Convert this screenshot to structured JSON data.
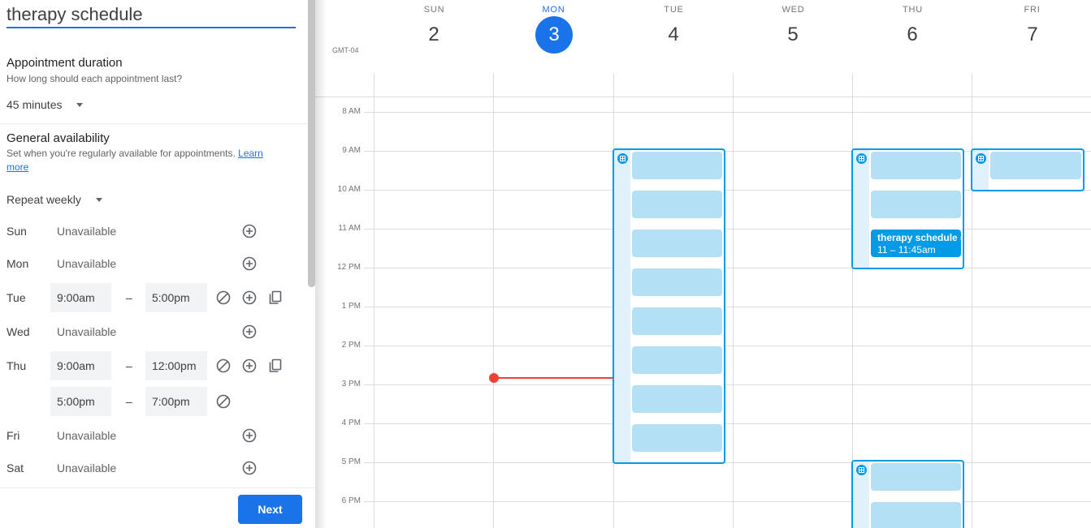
{
  "form": {
    "title_value": "therapy schedule",
    "duration": {
      "title": "Appointment duration",
      "subtitle": "How long should each appointment last?",
      "value": "45 minutes"
    },
    "availability": {
      "title": "General availability",
      "subtitle": "Set when you're regularly available for appointments.",
      "learn_more": "Learn more",
      "repeat": "Repeat weekly"
    },
    "dash": "–",
    "days": [
      {
        "label": "Sun",
        "status": "Unavailable"
      },
      {
        "label": "Mon",
        "status": "Unavailable"
      },
      {
        "label": "Tue",
        "start": "9:00am",
        "end": "5:00pm"
      },
      {
        "label": "Wed",
        "status": "Unavailable"
      },
      {
        "label": "Thu",
        "start": "9:00am",
        "end": "12:00pm",
        "start2": "5:00pm",
        "end2": "7:00pm"
      },
      {
        "label": "Fri",
        "status": "Unavailable"
      },
      {
        "label": "Sat",
        "status": "Unavailable"
      }
    ],
    "next_label": "Next"
  },
  "calendar": {
    "timezone": "GMT-04",
    "days": [
      {
        "dow": "SUN",
        "num": "2"
      },
      {
        "dow": "MON",
        "num": "3",
        "today": true
      },
      {
        "dow": "TUE",
        "num": "4"
      },
      {
        "dow": "WED",
        "num": "5"
      },
      {
        "dow": "THU",
        "num": "6"
      },
      {
        "dow": "FRI",
        "num": "7"
      }
    ],
    "hours": [
      "8 AM",
      "9 AM",
      "10 AM",
      "11 AM",
      "12 PM",
      "1 PM",
      "2 PM",
      "3 PM",
      "4 PM",
      "5 PM",
      "6 PM"
    ],
    "booked_event": {
      "title": "therapy schedule (",
      "time": "11 – 11:45am"
    }
  },
  "colors": {
    "accent": "#1a73e8",
    "slot": "#b3e0f5",
    "block_border": "#039be5",
    "now_indicator": "#ea4335"
  }
}
